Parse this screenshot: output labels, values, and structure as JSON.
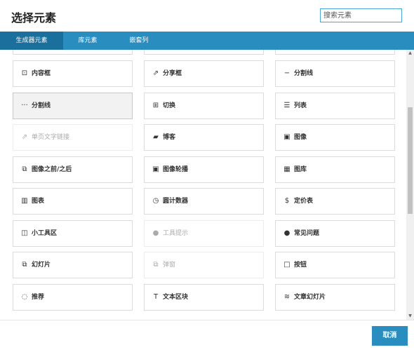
{
  "header": {
    "title": "选择元素"
  },
  "search": {
    "placeholder": "搜索元素"
  },
  "tabs": [
    {
      "label": "生成器元素",
      "active": true
    },
    {
      "label": "库元素",
      "active": false
    },
    {
      "label": "嵌套列",
      "active": false
    }
  ],
  "elements": [
    {
      "label": "内容框",
      "icon": "box-icon",
      "glyph": "⊡",
      "disabled": false
    },
    {
      "label": "分享框",
      "icon": "share-icon",
      "glyph": "⇗",
      "disabled": false
    },
    {
      "label": "分割线",
      "icon": "minus-icon",
      "glyph": "−",
      "disabled": false
    },
    {
      "label": "分割线",
      "icon": "dots-icon",
      "glyph": "···",
      "disabled": false,
      "highlighted": true
    },
    {
      "label": "切换",
      "icon": "toggle-icon",
      "glyph": "⊞",
      "disabled": false
    },
    {
      "label": "列表",
      "icon": "list-icon",
      "glyph": "☰",
      "disabled": false
    },
    {
      "label": "单页文字链接",
      "icon": "external-link-icon",
      "glyph": "⇗",
      "disabled": true
    },
    {
      "label": "博客",
      "icon": "book-icon",
      "glyph": "▰",
      "disabled": false
    },
    {
      "label": "图像",
      "icon": "image-icon",
      "glyph": "▣",
      "disabled": false
    },
    {
      "label": "图像之前/之后",
      "icon": "before-after-icon",
      "glyph": "⧉",
      "disabled": false
    },
    {
      "label": "图像轮播",
      "icon": "carousel-icon",
      "glyph": "▣",
      "disabled": false
    },
    {
      "label": "图库",
      "icon": "gallery-icon",
      "glyph": "▦",
      "disabled": false
    },
    {
      "label": "图表",
      "icon": "chart-icon",
      "glyph": "▥",
      "disabled": false
    },
    {
      "label": "圆计数器",
      "icon": "clock-icon",
      "glyph": "◷",
      "disabled": false
    },
    {
      "label": "定价表",
      "icon": "dollar-icon",
      "glyph": "$",
      "disabled": false
    },
    {
      "label": "小工具区",
      "icon": "columns-icon",
      "glyph": "◫",
      "disabled": false
    },
    {
      "label": "工具提示",
      "icon": "info-icon",
      "glyph": "●",
      "disabled": true
    },
    {
      "label": "常见问题",
      "icon": "info-circle-icon",
      "glyph": "●",
      "disabled": false
    },
    {
      "label": "幻灯片",
      "icon": "slides-icon",
      "glyph": "⧉",
      "disabled": false
    },
    {
      "label": "弹窗",
      "icon": "modal-icon",
      "glyph": "⧉",
      "disabled": true
    },
    {
      "label": "按钮",
      "icon": "button-icon",
      "glyph": "□",
      "disabled": false
    },
    {
      "label": "推荐",
      "icon": "comment-icon",
      "glyph": "◌",
      "disabled": false
    },
    {
      "label": "文本区块",
      "icon": "text-icon",
      "glyph": "T",
      "disabled": false
    },
    {
      "label": "文章幻灯片",
      "icon": "layers-icon",
      "glyph": "≋",
      "disabled": false
    }
  ],
  "footer": {
    "cancel_label": "取消"
  },
  "colors": {
    "accent": "#2a8dbf",
    "accent_dark": "#1b6f9c"
  }
}
